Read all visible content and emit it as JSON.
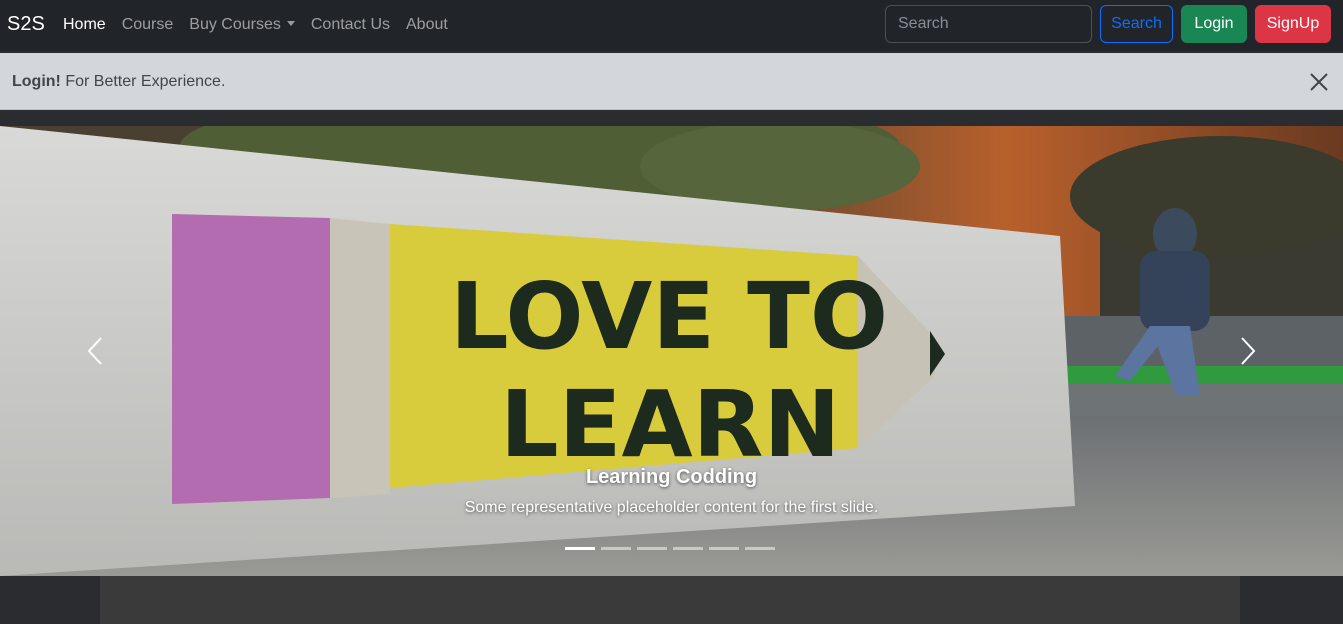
{
  "navbar": {
    "brand": "S2S",
    "links": [
      {
        "label": "Home"
      },
      {
        "label": "Course"
      },
      {
        "label": "Buy Courses"
      },
      {
        "label": "Contact Us"
      },
      {
        "label": "About"
      }
    ],
    "search_placeholder": "Search",
    "search_button": "Search",
    "login_button": "Login",
    "signup_button": "SignUp"
  },
  "alert": {
    "strong": "Login!",
    "message": "For Better Experience."
  },
  "carousel": {
    "sign_text_line1": "LOVE TO",
    "sign_text_line2": "LEARN",
    "caption_title": "Learning Codding",
    "caption_text": "Some representative placeholder content for the first slide.",
    "active_slide": 1,
    "slide_count": 6
  },
  "icons": {
    "close": "close-icon",
    "prev": "chevron-left-icon",
    "next": "chevron-right-icon",
    "dropdown": "caret-down-icon"
  },
  "colors": {
    "navbar_bg": "#212529",
    "primary": "#0d6efd",
    "success": "#198754",
    "danger": "#dc3545",
    "alert_bg": "#d3d6db"
  }
}
